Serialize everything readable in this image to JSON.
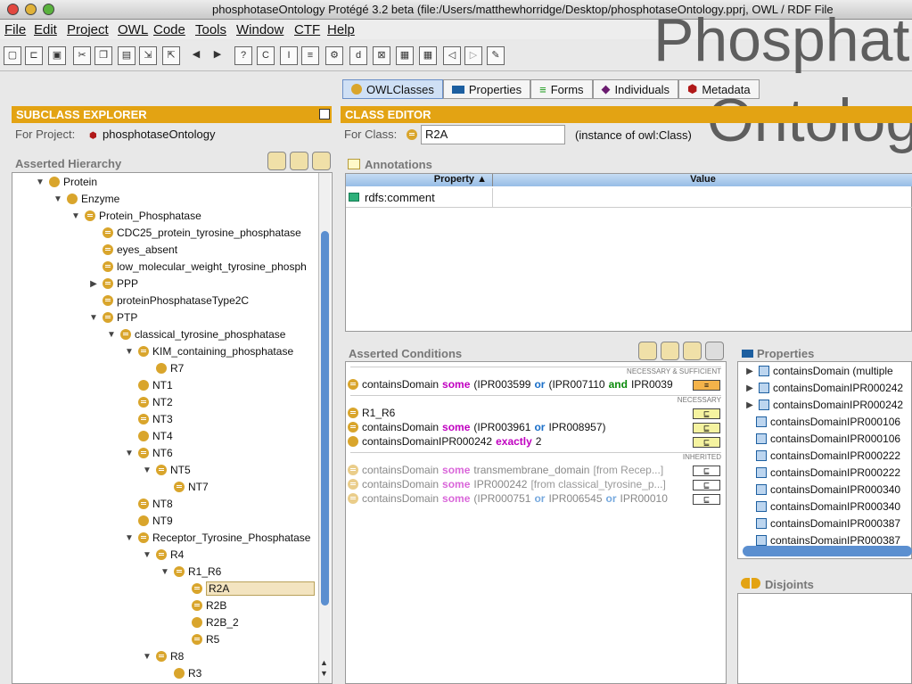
{
  "window": {
    "title": "phosphotaseOntology  Protégé 3.2 beta   (file:/Users/matthewhorridge/Desktop/phosphotaseOntology.pprj, OWL / RDF File"
  },
  "menu": [
    "File",
    "Edit",
    "Project",
    "OWL",
    "Code",
    "Tools",
    "Window",
    "CTF",
    "Help"
  ],
  "overlay": {
    "line1": "Phosphat",
    "line2": "Ontolog"
  },
  "tabs": [
    "OWLClasses",
    "Properties",
    "Forms",
    "Individuals",
    "Metadata"
  ],
  "subclass_explorer": {
    "header": "SUBCLASS EXPLORER",
    "for_project_label": "For Project:",
    "project": "phosphotaseOntology",
    "hierarchy_label": "Asserted Hierarchy"
  },
  "tree": [
    {
      "label": "Protein",
      "level": 0,
      "expand": "open",
      "icon": "plain"
    },
    {
      "label": "Enzyme",
      "level": 1,
      "expand": "open",
      "icon": "plain"
    },
    {
      "label": "Protein_Phosphatase",
      "level": 2,
      "expand": "open",
      "icon": "eq"
    },
    {
      "label": "CDC25_protein_tyrosine_phosphatase",
      "level": 3,
      "expand": "",
      "icon": "eq"
    },
    {
      "label": "eyes_absent",
      "level": 3,
      "expand": "",
      "icon": "eq"
    },
    {
      "label": "low_molecular_weight_tyrosine_phosph",
      "level": 3,
      "expand": "",
      "icon": "eq"
    },
    {
      "label": "PPP",
      "level": 3,
      "expand": "closed",
      "icon": "eq"
    },
    {
      "label": "proteinPhosphataseType2C",
      "level": 3,
      "expand": "",
      "icon": "eq"
    },
    {
      "label": "PTP",
      "level": 3,
      "expand": "open",
      "icon": "eq"
    },
    {
      "label": "classical_tyrosine_phosphatase",
      "level": 4,
      "expand": "open",
      "icon": "eq"
    },
    {
      "label": "KIM_containing_phosphatase",
      "level": 5,
      "expand": "open",
      "icon": "eq"
    },
    {
      "label": "R7",
      "level": 6,
      "expand": "",
      "icon": "plain"
    },
    {
      "label": "NT1",
      "level": 5,
      "expand": "",
      "icon": "plain"
    },
    {
      "label": "NT2",
      "level": 5,
      "expand": "",
      "icon": "eq"
    },
    {
      "label": "NT3",
      "level": 5,
      "expand": "",
      "icon": "eq"
    },
    {
      "label": "NT4",
      "level": 5,
      "expand": "",
      "icon": "plain"
    },
    {
      "label": "NT6",
      "level": 5,
      "expand": "open",
      "icon": "eq"
    },
    {
      "label": "NT5",
      "level": 6,
      "expand": "open",
      "icon": "eq"
    },
    {
      "label": "NT7",
      "level": 7,
      "expand": "",
      "icon": "eq"
    },
    {
      "label": "NT8",
      "level": 5,
      "expand": "",
      "icon": "eq"
    },
    {
      "label": "NT9",
      "level": 5,
      "expand": "",
      "icon": "plain"
    },
    {
      "label": "Receptor_Tyrosine_Phosphatase",
      "level": 5,
      "expand": "open",
      "icon": "eq"
    },
    {
      "label": "R4",
      "level": 6,
      "expand": "open",
      "icon": "eq"
    },
    {
      "label": "R1_R6",
      "level": 7,
      "expand": "open",
      "icon": "eq"
    },
    {
      "label": "R2A",
      "level": 8,
      "expand": "",
      "icon": "eq",
      "selected": true
    },
    {
      "label": "R2B",
      "level": 8,
      "expand": "",
      "icon": "eq"
    },
    {
      "label": "R2B_2",
      "level": 8,
      "expand": "",
      "icon": "plain"
    },
    {
      "label": "R5",
      "level": 8,
      "expand": "",
      "icon": "eq"
    },
    {
      "label": "R8",
      "level": 6,
      "expand": "open",
      "icon": "eq"
    },
    {
      "label": "R3",
      "level": 7,
      "expand": "",
      "icon": "plain"
    }
  ],
  "class_editor": {
    "header": "CLASS EDITOR",
    "for_class_label": "For Class:",
    "class_name": "R2A",
    "instance_of": "(instance of owl:Class)",
    "annotations_label": "Annotations",
    "col_property": "Property",
    "col_value": "Value",
    "annotation_row": "rdfs:comment"
  },
  "conditions": {
    "label": "Asserted Conditions",
    "sec_ns": "NECESSARY & SUFFICIENT",
    "sec_n": "NECESSARY",
    "sec_inh": "INHERITED",
    "ns": [
      {
        "p": "containsDomain ",
        "k": "some",
        "r": " (IPR003599 ",
        "o1": "or",
        "m": " (IPR007110 ",
        "o2": "and",
        "e": " IPR0039"
      }
    ],
    "n": [
      {
        "text": "R1_R6"
      },
      {
        "p": "containsDomain ",
        "k": "some",
        "r": " (IPR003961 ",
        "o1": "or",
        "e": " IPR008957)"
      },
      {
        "p": "containsDomainIPR000242 ",
        "k": "exactly",
        "e": " 2"
      }
    ],
    "inh": [
      {
        "p": "containsDomain ",
        "k": "some",
        "r": " transmembrane_domain ",
        "from": "[from Recep...]"
      },
      {
        "p": "containsDomain ",
        "k": "some",
        "r": " IPR000242 ",
        "from": "[from classical_tyrosine_p...]"
      },
      {
        "p": "containsDomain ",
        "k": "some",
        "r": " (IPR000751 ",
        "o1": "or",
        "m": " IPR006545 ",
        "o2": "or",
        "e": " IPR00010"
      }
    ],
    "badge": "⊑",
    "badge_eq": "≡"
  },
  "properties": {
    "label": "Properties",
    "items": [
      "containsDomain  (multiple",
      "containsDomainIPR000242",
      "containsDomainIPR000242",
      "containsDomainIPR000106",
      "containsDomainIPR000106",
      "containsDomainIPR000222",
      "containsDomainIPR000222",
      "containsDomainIPR000340",
      "containsDomainIPR000340",
      "containsDomainIPR000387",
      "containsDomainIPR000387"
    ],
    "multiple_note": "(multiple"
  },
  "disjoints": {
    "label": "Disjoints"
  },
  "colors": {
    "accent": "#e3a313",
    "class_icon": "#d9a52c",
    "keyword": "#c000c0",
    "or": "#1a6fc9",
    "and": "#0a8a0a"
  }
}
